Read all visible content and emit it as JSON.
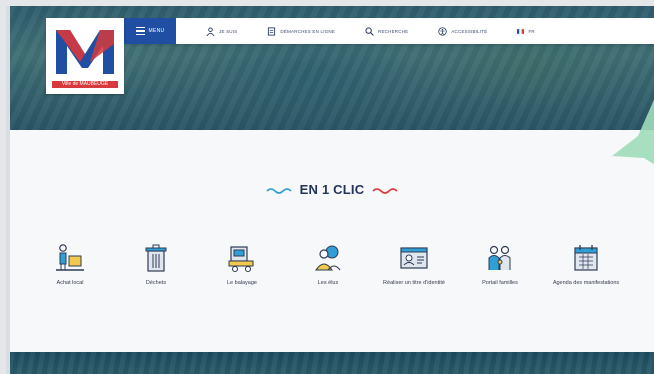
{
  "header": {
    "logo_caption": "Ville de MAUBEUGE",
    "menu_label": "MENU",
    "nav_items": [
      {
        "label": "JE SUIS",
        "icon": "person-icon"
      },
      {
        "label": "DÉMARCHES EN LIGNE",
        "icon": "document-icon"
      },
      {
        "label": "RECHERCHE",
        "icon": "search-icon"
      },
      {
        "label": "ACCESSIBILITÉ",
        "icon": "accessibility-icon"
      },
      {
        "label": "FR",
        "icon": "flag-icon"
      }
    ]
  },
  "main": {
    "section_title": "EN 1 CLIC",
    "tiles": [
      {
        "label": "Achat local",
        "icon": "shopping-icon"
      },
      {
        "label": "Déchets",
        "icon": "trash-bin-icon"
      },
      {
        "label": "Le balayage",
        "icon": "street-sweeper-icon"
      },
      {
        "label": "Les élus",
        "icon": "elected-officials-icon"
      },
      {
        "label": "Réaliser un titre d'identité",
        "icon": "id-card-icon"
      },
      {
        "label": "Portail familles",
        "icon": "family-icon"
      },
      {
        "label": "Agenda des manifestations",
        "icon": "calendar-icon"
      }
    ]
  },
  "colors": {
    "brand_blue": "#1f4ea3",
    "accent_red": "#d7393c",
    "accent_cyan": "#2f9fd6",
    "green_overlay": "#9fdcb9"
  }
}
